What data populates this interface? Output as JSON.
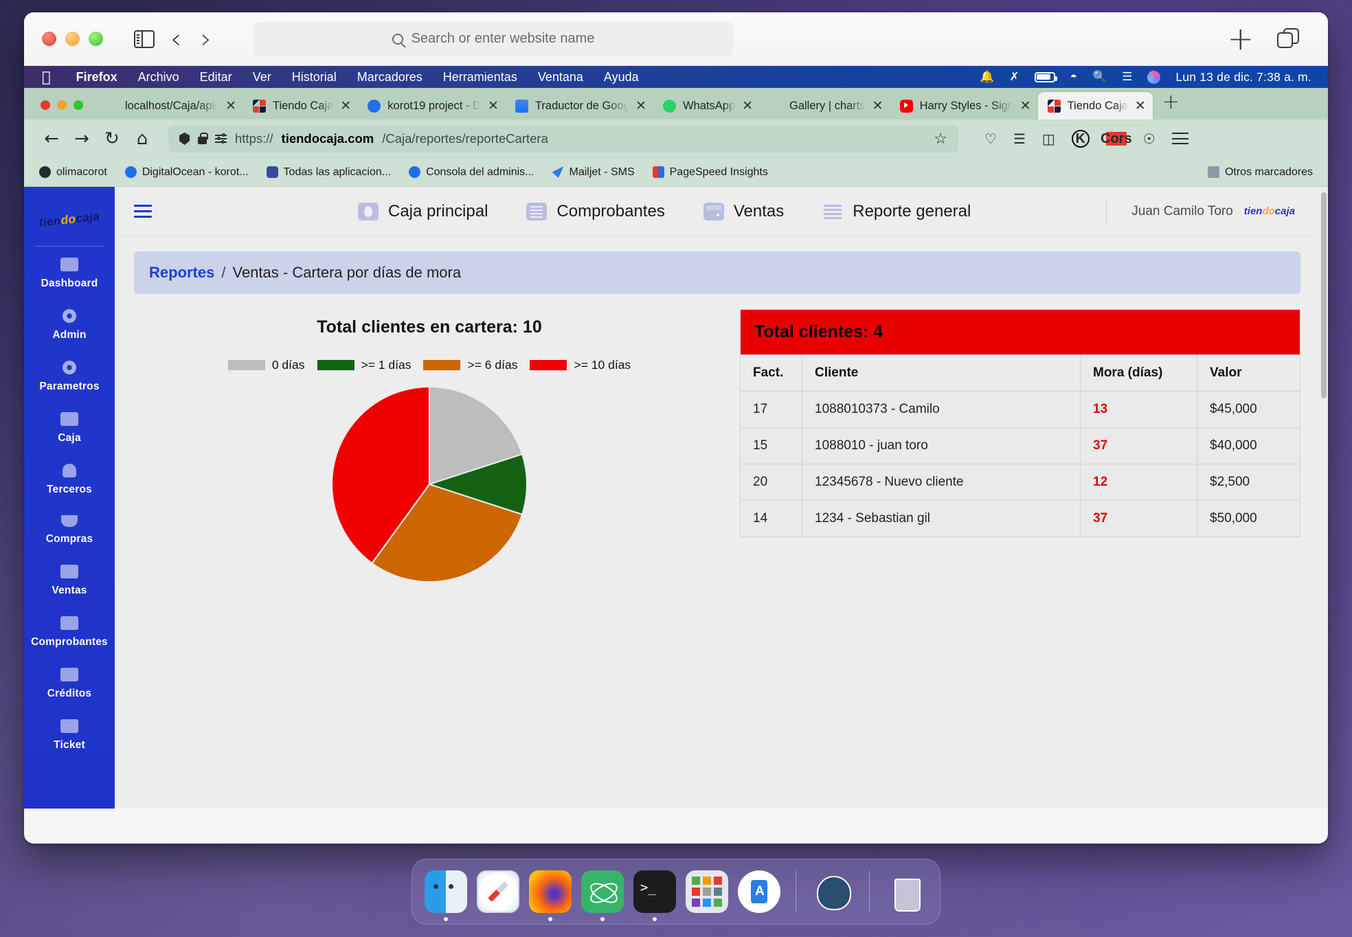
{
  "safari_chrome": {
    "search_placeholder": "Search or enter website name",
    "icons": {
      "sidebar": "sidebar-icon",
      "back": "back-chevron-icon",
      "forward": "forward-chevron-icon",
      "new_tab": "plus-icon",
      "tab_overview": "tab-overview-icon"
    }
  },
  "menubar": {
    "apple": "",
    "items": [
      "Firefox",
      "Archivo",
      "Editar",
      "Ver",
      "Historial",
      "Marcadores",
      "Herramientas",
      "Ventana",
      "Ayuda"
    ],
    "status_icons": [
      "notification-bell-icon",
      "bluetooth-off-icon",
      "battery-icon",
      "wifi-icon",
      "spotlight-search-icon",
      "control-center-icon",
      "siri-icon"
    ],
    "clock": "Lun 13 de dic.  7:38 a. m."
  },
  "firefox": {
    "tabs": [
      {
        "title": "localhost/Caja/api/repo",
        "favicon": "none",
        "active": false
      },
      {
        "title": "Tiendo Caja",
        "favicon": "tienda",
        "active": false
      },
      {
        "title": "korot19 project - D",
        "favicon": "do",
        "active": false
      },
      {
        "title": "Traductor de Goog",
        "favicon": "gt",
        "active": false
      },
      {
        "title": "WhatsApp",
        "favicon": "wa",
        "active": false
      },
      {
        "title": "Gallery | charts",
        "favicon": "none",
        "active": false
      },
      {
        "title": "Harry Styles - Sign",
        "favicon": "yt",
        "active": false
      },
      {
        "title": "Tiendo Caja",
        "favicon": "tienda",
        "active": true
      }
    ],
    "tab_close_label": "✕",
    "new_tab_label": "+",
    "nav": {
      "back": "←",
      "forward": "→",
      "reload": "↻",
      "home": "⌂"
    },
    "url": {
      "scheme": "https://",
      "host": "tiendocaja.com",
      "path": "/Caja/reportes/reporteCartera"
    },
    "bookmark_star": "☆",
    "toolbar_icons": [
      "pocket-icon",
      "library-icon",
      "reader-view-icon",
      "kiwi-extension-icon",
      "cors-extension-icon",
      "sync-icon",
      "menu-icon"
    ],
    "bookmarks": [
      {
        "label": "olimacorot",
        "icon": "gh"
      },
      {
        "label": "DigitalOcean - korot...",
        "icon": "do2"
      },
      {
        "label": "Todas las aplicacion...",
        "icon": "ap"
      },
      {
        "label": "Consola del adminis...",
        "icon": "fb"
      },
      {
        "label": "Mailjet - SMS",
        "icon": "mj"
      },
      {
        "label": "PageSpeed Insights",
        "icon": "ps"
      }
    ],
    "bookmarks_right": {
      "label": "Otros marcadores",
      "icon": "folder"
    }
  },
  "app": {
    "sidebar": {
      "brand": {
        "part1": "tien",
        "part2": "do",
        "part3": " caja"
      },
      "items": [
        {
          "label": "Dashboard",
          "icon": "dashboard-icon"
        },
        {
          "label": "Admin",
          "icon": "gear-icon"
        },
        {
          "label": "Parametros",
          "icon": "gear-icon"
        },
        {
          "label": "Caja",
          "icon": "cash-icon"
        },
        {
          "label": "Terceros",
          "icon": "person-icon"
        },
        {
          "label": "Compras",
          "icon": "basket-icon"
        },
        {
          "label": "Ventas",
          "icon": "wallet-icon"
        },
        {
          "label": "Comprobantes",
          "icon": "receipt-icon"
        },
        {
          "label": "Créditos",
          "icon": "card-icon"
        },
        {
          "label": "Ticket",
          "icon": "ticket-icon"
        }
      ]
    },
    "topnav": {
      "menu_toggle": "hamburger-icon",
      "items": [
        {
          "label": "Caja principal",
          "icon": "cash"
        },
        {
          "label": "Comprobantes",
          "icon": "list"
        },
        {
          "label": "Ventas",
          "icon": "wallet"
        },
        {
          "label": "Reporte general",
          "icon": "bars"
        }
      ],
      "user": "Juan Camilo Toro",
      "user_logo": {
        "part1": "tien",
        "part2": "do",
        "part3": "caja"
      }
    },
    "breadcrumb": {
      "root": "Reportes",
      "separator": "/",
      "current": "Ventas - Cartera por días de mora"
    },
    "table": {
      "banner": "Total clientes: 4",
      "headers": [
        "Fact.",
        "Cliente",
        "Mora (días)",
        "Valor"
      ],
      "rows": [
        {
          "fact": "17",
          "cliente": "1088010373 - Camilo",
          "mora": "13",
          "valor": "$45,000"
        },
        {
          "fact": "15",
          "cliente": "1088010 - juan toro",
          "mora": "37",
          "valor": "$40,000"
        },
        {
          "fact": "20",
          "cliente": "12345678 - Nuevo cliente",
          "mora": "12",
          "valor": "$2,500"
        },
        {
          "fact": "14",
          "cliente": "1234 - Sebastian gil",
          "mora": "37",
          "valor": "$50,000"
        }
      ]
    }
  },
  "chart_data": {
    "type": "pie",
    "title": "Total clientes en cartera: 10",
    "categories": [
      "0 días",
      ">= 1 días",
      ">= 6 días",
      ">= 10 días"
    ],
    "values": [
      2,
      1,
      3,
      4
    ],
    "colors": [
      "#bdbdbd",
      "#136313",
      "#cc6600",
      "#f20000"
    ],
    "legend_position": "top",
    "total": 10
  },
  "dock": {
    "items": [
      {
        "name": "finder",
        "class": "d-finder",
        "running": true
      },
      {
        "name": "safari",
        "class": "d-safari",
        "running": false
      },
      {
        "name": "firefox",
        "class": "d-firefox",
        "running": true
      },
      {
        "name": "atom",
        "class": "d-atom",
        "running": true
      },
      {
        "name": "terminal",
        "class": "d-term",
        "running": true
      },
      {
        "name": "launchpad",
        "class": "d-launch",
        "running": false
      },
      {
        "name": "android-studio",
        "class": "d-studio",
        "running": false
      },
      {
        "name": "postgresql",
        "class": "d-pg",
        "running": false
      },
      {
        "name": "trash",
        "class": "d-trash",
        "running": false
      }
    ]
  }
}
